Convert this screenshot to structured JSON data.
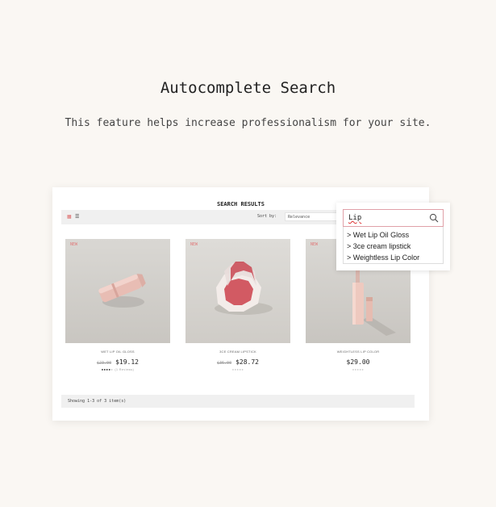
{
  "hero": {
    "title": "Autocomplete Search",
    "subtitle": "This feature helps increase professionalism for your site."
  },
  "results": {
    "title": "SEARCH RESULTS",
    "sort_label": "Sort by:",
    "sort_value": "Relevance",
    "footer": "Showing 1-3 of 3 item(s)"
  },
  "products": [
    {
      "badge": "NEW",
      "name": "WET LIP OIL GLOSS",
      "old_price": "$23.00",
      "price": "$19.12",
      "rating": 4,
      "reviews": "(1 Reviews)"
    },
    {
      "badge": "NEW",
      "name": "3CE CREAM LIPSTICK",
      "old_price": "$36.00",
      "price": "$28.72",
      "rating": 0,
      "reviews": ""
    },
    {
      "badge": "NEW",
      "name": "WEIGHTLESS LIP COLOR",
      "old_price": "",
      "price": "$29.00",
      "rating": 0,
      "reviews": ""
    }
  ],
  "autocomplete": {
    "query": "Lip",
    "suggestions": [
      "> Wet Lip Oil Gloss",
      "> 3ce cream lipstick",
      "> Weightless Lip Color"
    ],
    "search_icon": "search-icon"
  },
  "colors": {
    "accent": "#e07a7a",
    "background": "#faf7f3"
  }
}
